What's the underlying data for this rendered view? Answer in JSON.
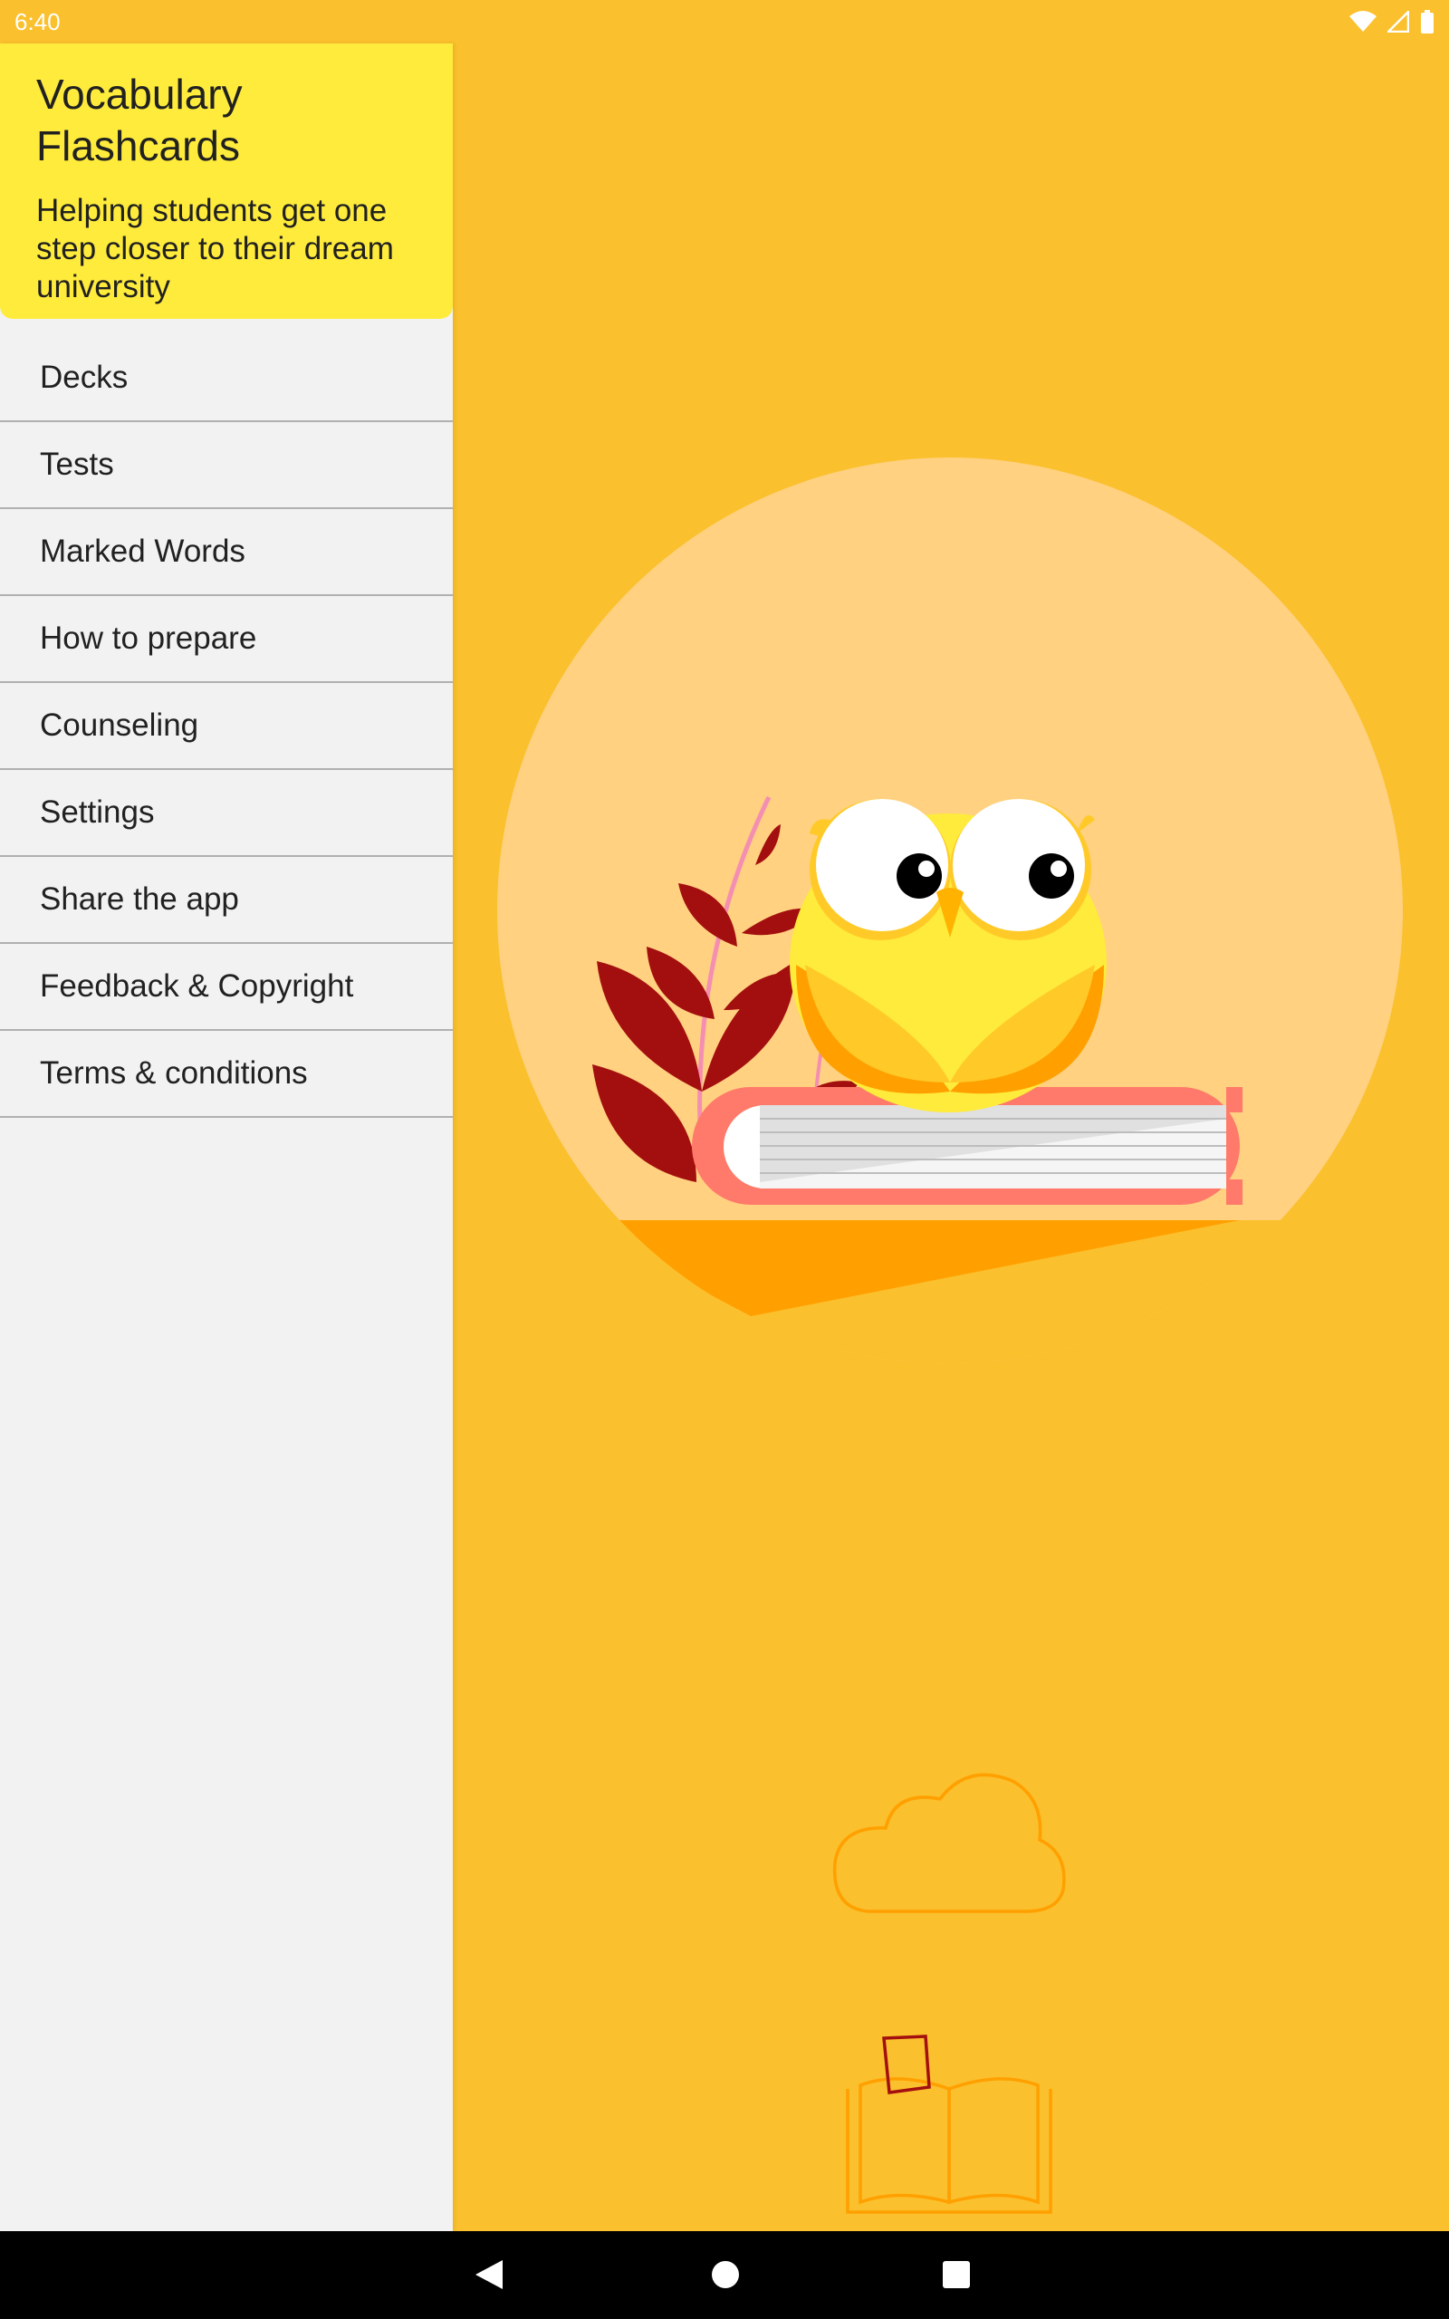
{
  "status_bar": {
    "time": "6:40",
    "icons": [
      "wifi-icon",
      "signal-icon",
      "battery-icon"
    ]
  },
  "drawer": {
    "title": "Vocabulary Flashcards",
    "subtitle": "Helping students get one step closer to their dream university",
    "menu_items": [
      {
        "label": "Decks"
      },
      {
        "label": "Tests"
      },
      {
        "label": "Marked Words"
      },
      {
        "label": "How to prepare"
      },
      {
        "label": "Counseling"
      },
      {
        "label": "Settings"
      },
      {
        "label": "Share the app"
      },
      {
        "label": "Feedback & Copyright"
      },
      {
        "label": "Terms & conditions"
      }
    ]
  },
  "nav_bar": {
    "buttons": [
      "back-icon",
      "home-icon",
      "recents-icon"
    ]
  },
  "colors": {
    "background": "#FBC02D",
    "drawer_header": "#FFEB3B",
    "drawer_body": "#F2F2F2",
    "divider": "#B0B0B0",
    "hero_circle": "#FFD180"
  }
}
